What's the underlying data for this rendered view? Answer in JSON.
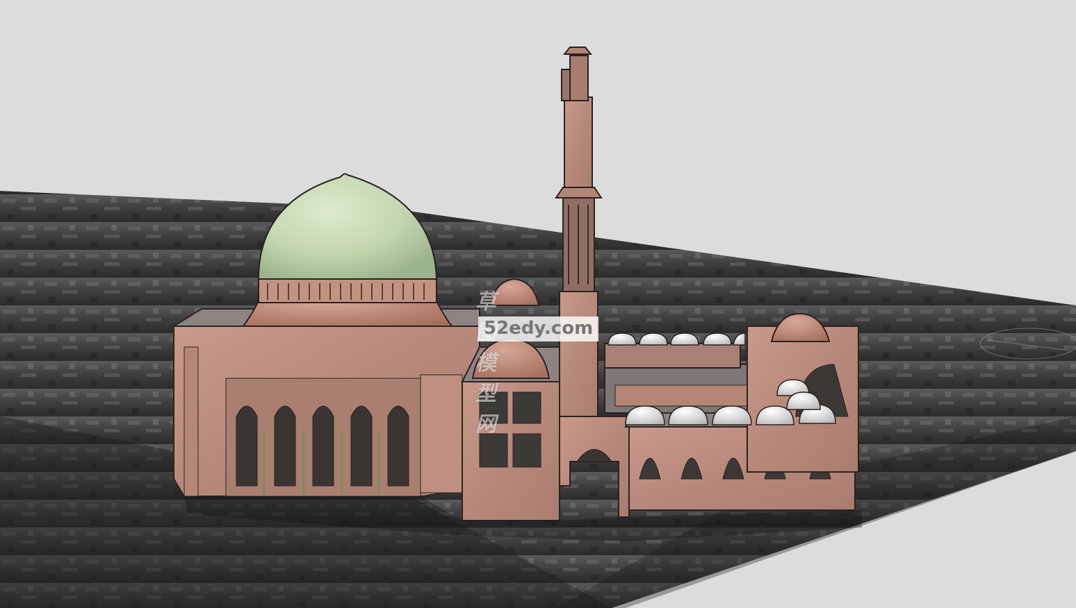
{
  "watermark": {
    "chinese": "草图模型网",
    "url": "52edy.com"
  },
  "colors": {
    "sky": "#dcdcdc",
    "terrain": "#4a4a4a",
    "brick": "#b98a78",
    "brick_dark": "#8e6a5c",
    "dome_green": "#c7dcb4",
    "small_dome": "#eeeeee",
    "outline": "#2a2220"
  }
}
